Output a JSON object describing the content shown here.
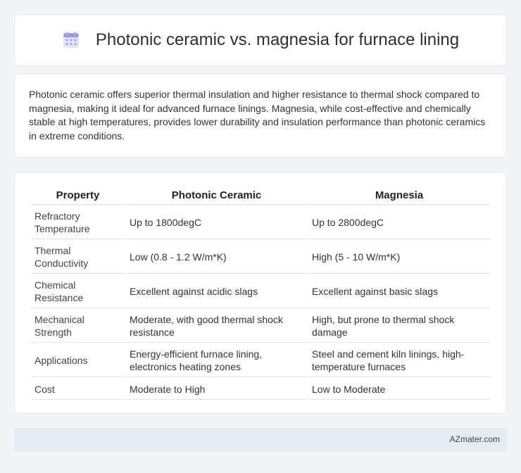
{
  "header": {
    "title": "Photonic ceramic vs. magnesia for furnace lining",
    "icon": "calendar-grid-icon"
  },
  "summary": {
    "text": "Photonic ceramic offers superior thermal insulation and higher resistance to thermal shock compared to magnesia, making it ideal for advanced furnace linings. Magnesia, while cost-effective and chemically stable at high temperatures, provides lower durability and insulation performance than photonic ceramics in extreme conditions."
  },
  "table": {
    "headers": [
      "Property",
      "Photonic Ceramic",
      "Magnesia"
    ],
    "rows": [
      [
        "Refractory Temperature",
        "Up to 1800degC",
        "Up to 2800degC"
      ],
      [
        "Thermal Conductivity",
        "Low (0.8 - 1.2 W/m*K)",
        "High (5 - 10 W/m*K)"
      ],
      [
        "Chemical Resistance",
        "Excellent against acidic slags",
        "Excellent against basic slags"
      ],
      [
        "Mechanical Strength",
        "Moderate, with good thermal shock resistance",
        "High, but prone to thermal shock damage"
      ],
      [
        "Applications",
        "Energy-efficient furnace lining, electronics heating zones",
        "Steel and cement kiln linings, high-temperature furnaces"
      ],
      [
        "Cost",
        "Moderate to High",
        "Low to Moderate"
      ]
    ]
  },
  "footer": {
    "brand": "AZmater.com"
  }
}
